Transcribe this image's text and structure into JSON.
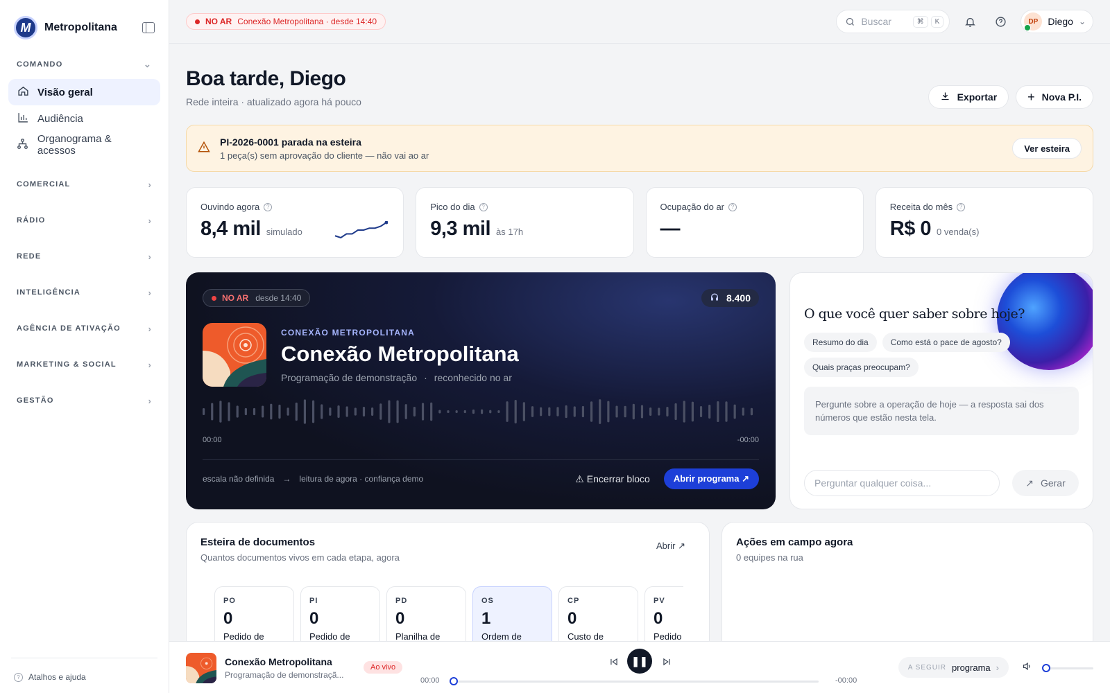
{
  "brand": {
    "name": "Metropolitana",
    "logo_letter": "M"
  },
  "sidebar": {
    "sections": [
      {
        "label": "COMANDO",
        "expanded": true
      },
      {
        "label": "COMERCIAL"
      },
      {
        "label": "RÁDIO"
      },
      {
        "label": "REDE"
      },
      {
        "label": "INTELIGÊNCIA"
      },
      {
        "label": "AGÊNCIA DE ATIVAÇÃO"
      },
      {
        "label": "MARKETING & SOCIAL"
      },
      {
        "label": "GESTÃO"
      }
    ],
    "items": [
      {
        "label": "Visão geral",
        "icon": "home-icon",
        "active": true
      },
      {
        "label": "Audiência",
        "icon": "bar-chart-icon"
      },
      {
        "label": "Organograma & acessos",
        "icon": "org-chart-icon"
      }
    ],
    "help": "Atalhos e ajuda"
  },
  "topbar": {
    "onair": "NO AR",
    "onair_detail": "Conexão Metropolitana · desde 14:40",
    "search_placeholder": "Buscar",
    "kbd1": "⌘",
    "kbd2": "K",
    "user_initials": "DP",
    "user_name": "Diego"
  },
  "header": {
    "greeting": "Boa tarde, Diego",
    "subtitle": "Rede inteira · atualizado agora há pouco",
    "export_label": "Exportar",
    "new_label": "Nova P.I."
  },
  "alert": {
    "title": "PI-2026-0001 parada na esteira",
    "desc": "1 peça(s) sem aprovação do cliente — não vai ao ar",
    "button": "Ver esteira"
  },
  "kpis": [
    {
      "label": "Ouvindo agora",
      "value": "8,4 mil",
      "note": "simulado",
      "sparkline": [
        3,
        2,
        4,
        4,
        6,
        6,
        7,
        7,
        8,
        10
      ]
    },
    {
      "label": "Pico do dia",
      "value": "9,3 mil",
      "note": "às 17h"
    },
    {
      "label": "Ocupação do ar",
      "value": "—",
      "note": ""
    },
    {
      "label": "Receita do mês",
      "value": "R$ 0",
      "note": "0 venda(s)"
    }
  ],
  "player": {
    "onair": "NO AR",
    "since": "desde 14:40",
    "listeners": "8.400",
    "kicker": "CONEXÃO METROPOLITANA",
    "title": "Conexão Metropolitana",
    "sub1": "Programação de demonstração",
    "sub2": "reconhecido no ar",
    "time_start": "00:00",
    "time_end": "-00:00",
    "foot1": "escala não definida",
    "foot2": "leitura de agora · confiança demo",
    "end_label": "Encerrar bloco",
    "open_label": "Abrir programa"
  },
  "ai": {
    "question": "O que você quer saber sobre hoje?",
    "chips": [
      "Resumo do dia",
      "Como está o pace de agosto?",
      "Quais praças preocupam?"
    ],
    "hint": "Pergunte sobre a operação de hoje — a resposta sai dos números que estão nesta tela.",
    "input_placeholder": "Perguntar qualquer coisa...",
    "generate_label": "Gerar"
  },
  "docs": {
    "title": "Esteira de documentos",
    "subtitle": "Quantos documentos vivos em cada etapa, agora",
    "open_label": "Abrir",
    "stages": [
      {
        "code": "PO",
        "count": "0",
        "name": "Pedido de"
      },
      {
        "code": "PI",
        "count": "0",
        "name": "Pedido de"
      },
      {
        "code": "PD",
        "count": "0",
        "name": "Planilha de"
      },
      {
        "code": "OS",
        "count": "1",
        "name": "Ordem de",
        "highlight": true
      },
      {
        "code": "CP",
        "count": "0",
        "name": "Custo de"
      },
      {
        "code": "PV",
        "count": "0",
        "name": "Pedido"
      }
    ]
  },
  "field": {
    "title": "Ações em campo agora",
    "subtitle": "0 equipes na rua"
  },
  "bottombar": {
    "title": "Conexão Metropolitana",
    "sub": "Programação de demonstraçã...",
    "live": "Ao vivo",
    "time_start": "00:00",
    "time_end": "-00:00",
    "next_kicker": "A SEGUIR",
    "next_label": "programa",
    "progress": 0
  }
}
